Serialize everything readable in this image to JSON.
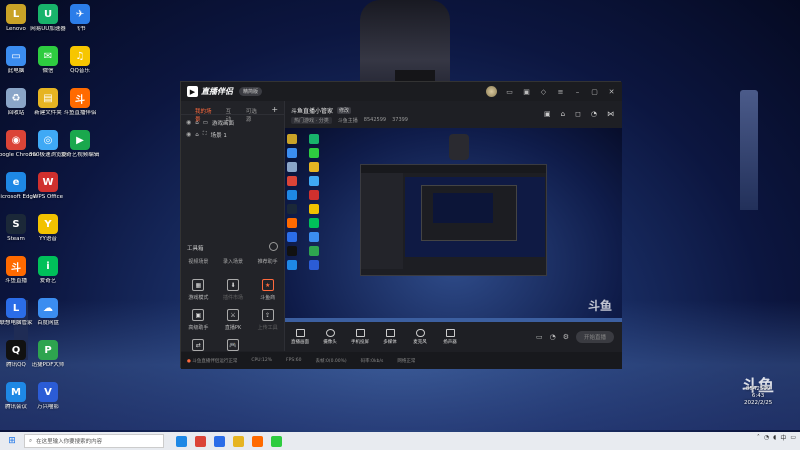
{
  "desktop": {
    "icons": [
      {
        "label": "Lenovo",
        "color": "#c9a227",
        "glyph": "L"
      },
      {
        "label": "Google Chrome",
        "color": "#db4437",
        "glyph": "◉"
      },
      {
        "label": "Microsoft Edge",
        "color": "#1e88e5",
        "glyph": "e"
      },
      {
        "label": "Steam",
        "color": "#1b2838",
        "glyph": "S"
      },
      {
        "label": "斗鱼直播",
        "color": "#ff6a00",
        "glyph": "斗"
      },
      {
        "label": "联想电脑管家",
        "color": "#2b6de8",
        "glyph": "L"
      },
      {
        "label": "腾讯QQ",
        "color": "#111111",
        "glyph": "Q"
      },
      {
        "label": "腾讯会议",
        "color": "#1e88e5",
        "glyph": "M"
      }
    ],
    "icons_col2": [
      {
        "label": "网易UU加速器",
        "color": "#18b36b",
        "glyph": "U"
      },
      {
        "label": "360极速浏览器",
        "color": "#3fa9f5",
        "glyph": "◎"
      },
      {
        "label": "WPS Office",
        "color": "#d0302e",
        "glyph": "W"
      },
      {
        "label": "YY语音",
        "color": "#f2c200",
        "glyph": "Y"
      },
      {
        "label": "爱奇艺",
        "color": "#00c05a",
        "glyph": "i"
      },
      {
        "label": "百度网盘",
        "color": "#3b8df0",
        "glyph": "☁"
      },
      {
        "label": "迅捷PDF大师",
        "color": "#2ea44f",
        "glyph": "P"
      },
      {
        "label": "万兴喵影",
        "color": "#2b5cd6",
        "glyph": "V"
      }
    ],
    "icons_col_left_extra": [
      {
        "label": "此电脑",
        "color": "#3b8df0",
        "glyph": "▭"
      },
      {
        "label": "回收站",
        "color": "#8aa5c8",
        "glyph": "♻"
      }
    ],
    "icons_col2_extra": [
      {
        "label": "微信",
        "color": "#2ecc40",
        "glyph": "✉"
      },
      {
        "label": "新建文件夹",
        "color": "#e6b422",
        "glyph": "▤"
      }
    ],
    "icons_col3": [
      {
        "label": "飞书",
        "color": "#2b7de9",
        "glyph": "✈"
      },
      {
        "label": "QQ音乐",
        "color": "#f7c600",
        "glyph": "♫"
      },
      {
        "label": "斗鱼直播伴侣",
        "color": "#ff6a00",
        "glyph": "斗"
      },
      {
        "label": "爱奇艺视频编辑",
        "color": "#1aa84d",
        "glyph": "▶"
      }
    ]
  },
  "app": {
    "title": "直播伴侣",
    "version_badge": "精简版",
    "left_tabs": [
      "我的场景",
      "互动",
      "可选源"
    ],
    "scenes": [
      "游戏画面",
      "场景 1"
    ],
    "toolbox_title": "工具箱",
    "tool_top_labels": [
      "视频场景",
      "录入场景",
      "推荐助手"
    ],
    "tools": [
      {
        "label": "游戏模式",
        "glyph": "▦",
        "hot": false,
        "dim": false
      },
      {
        "label": "插件市场",
        "glyph": "⬇",
        "hot": false,
        "dim": true
      },
      {
        "label": "斗鱼商",
        "glyph": "★",
        "hot": true,
        "dim": false
      },
      {
        "label": "高级助手",
        "glyph": "▣",
        "hot": false,
        "dim": false
      },
      {
        "label": "直播PK",
        "glyph": "⚔",
        "hot": false,
        "dim": false
      },
      {
        "label": "上传工具",
        "glyph": "⇪",
        "hot": false,
        "dim": true
      },
      {
        "label": "上传一起玩",
        "glyph": "⇄",
        "hot": false,
        "dim": false
      },
      {
        "label": "小游戏",
        "glyph": "🎮",
        "hot": false,
        "dim": false
      }
    ],
    "room_title": "斗鱼直播小管家",
    "room_edit": "修改",
    "room_tag": "热门游戏 · 分类",
    "room_meta_owner": "斗鱼主播",
    "room_id": "8542599",
    "room_hot": "37399",
    "controls": [
      "直播画面",
      "摄像头",
      "手机投屏",
      "多媒体",
      "麦克风",
      "扬声器"
    ],
    "start_label": "开始直播",
    "status_items": [
      "斗鱼直播伴侣运行正常",
      "CPU:12%",
      "FPS:60",
      "丢帧:0(0.00%)",
      "码率:0kb/s",
      "网络正常"
    ],
    "watermark": "斗鱼",
    "accent": "#ff6a3d"
  },
  "taskbar": {
    "search_placeholder": "在这里输入你要搜索的内容",
    "time": "6:43",
    "date": "2022/2/25"
  },
  "overlay": {
    "brand": "斗鱼",
    "room_number": "8542599"
  }
}
